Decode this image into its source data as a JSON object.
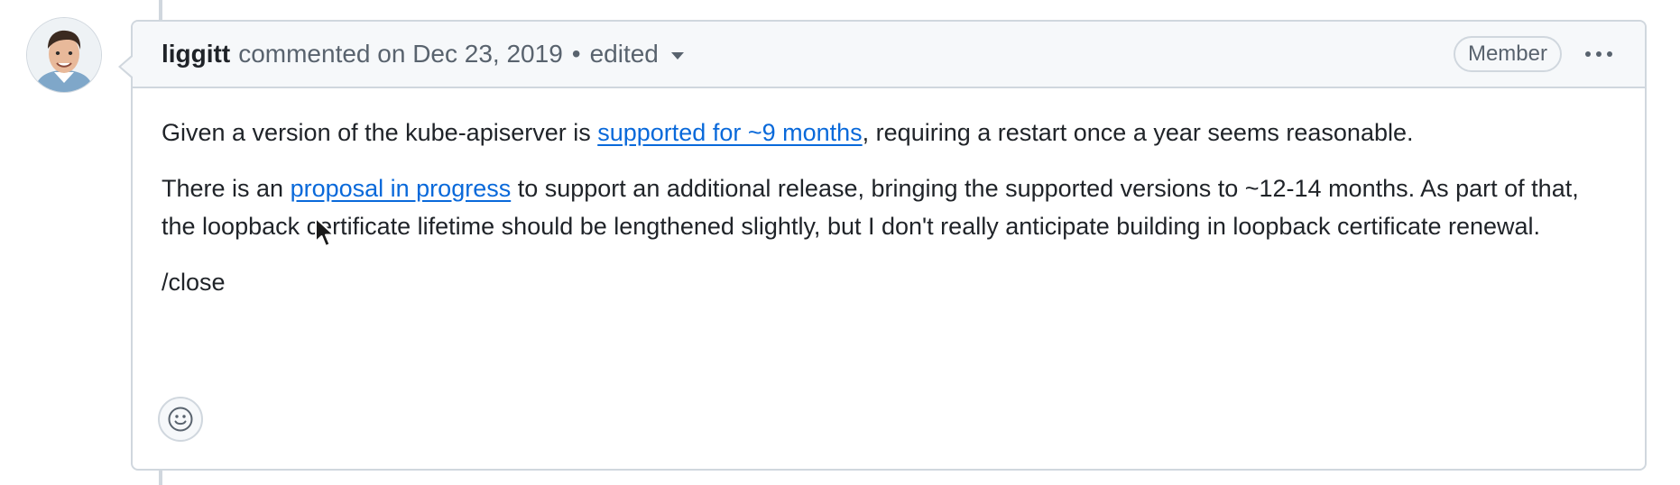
{
  "comment": {
    "author": "liggitt",
    "action": "commented on Dec 23, 2019",
    "separator": "•",
    "edited_label": "edited",
    "role_badge": "Member",
    "body": {
      "p1_before": "Given a version of the kube-apiserver is ",
      "p1_link": "supported for ~9 months",
      "p1_after": ", requiring a restart once a year seems reasonable.",
      "p2_before": "There is an ",
      "p2_link": "proposal in progress",
      "p2_after": " to support an additional release, bringing the supported versions to ~12-14 months. As part of that, the loopback certificate lifetime should be lengthened slightly, but I don't really anticipate building in loopback certificate renewal.",
      "p3": "/close"
    }
  },
  "icons": {
    "avatar": "user-avatar",
    "reaction": "smiley-icon",
    "menu": "kebab-horizontal-icon",
    "caret": "triangle-down-icon",
    "cursor": "mouse-pointer-icon"
  },
  "colors": {
    "link": "#0969da",
    "border": "#d0d7de",
    "header_bg": "#f6f8fa",
    "muted_text": "#59636e"
  }
}
